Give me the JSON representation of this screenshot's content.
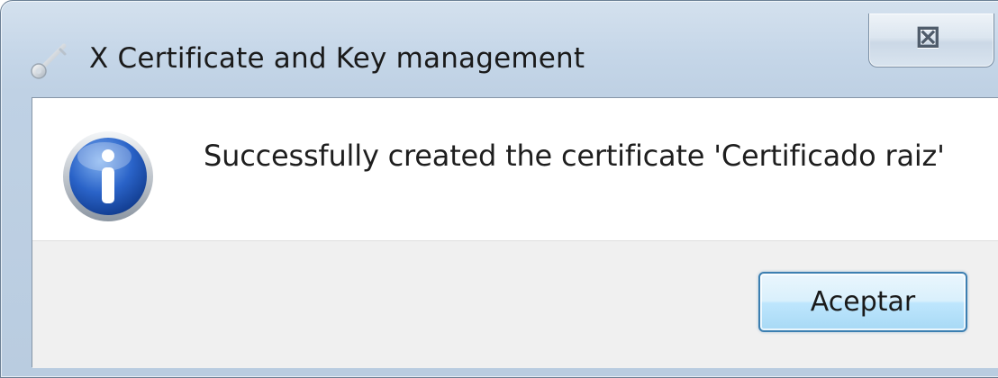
{
  "window": {
    "title": "X Certificate and Key management",
    "close_glyph": "⊠",
    "title_icon": "key-icon",
    "colors": {
      "title_frame": "#c5d6e8",
      "button_border": "#3c7fb1"
    }
  },
  "dialog": {
    "icon": "info-icon",
    "message": "Successfully created the certificate 'Certificado raiz'",
    "buttons": {
      "accept_label": "Aceptar"
    }
  }
}
